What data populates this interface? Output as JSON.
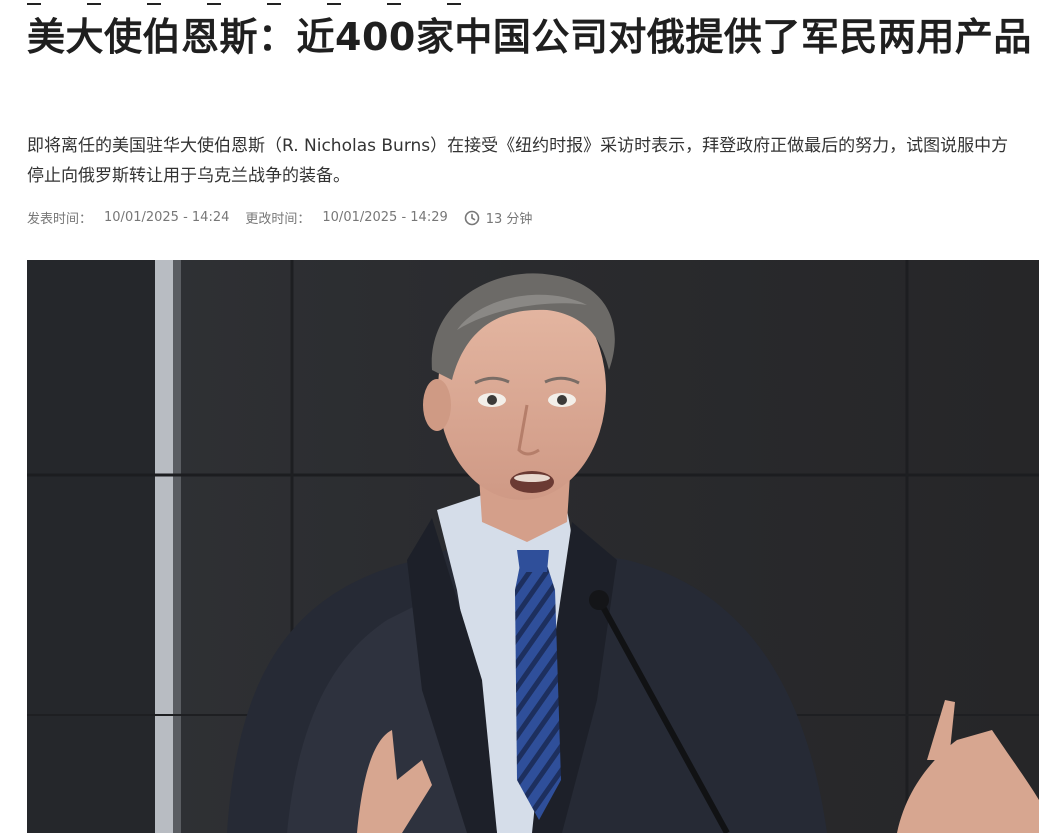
{
  "article": {
    "headline": "美大使伯恩斯：近400家中国公司对俄提供了军民两用产品",
    "lead": "即将离任的美国驻华大使伯恩斯（R. Nicholas Burns）在接受《纽约时报》采访时表示，拜登政府正做最后的努力，试图说服中方停止向俄罗斯转让用于乌克兰战争的装备。",
    "meta": {
      "published_label": "发表时间：",
      "published_value": "10/01/2025 - 14:24",
      "updated_label": "更改时间：",
      "updated_value": "10/01/2025 - 14:29",
      "read_time": "13 分钟"
    }
  },
  "icons": {
    "clock": "clock-icon"
  },
  "colors": {
    "headline": "#1f1f1f",
    "body_text": "#333333",
    "meta_text": "#777777",
    "photo_background": "#2a2a2c",
    "suit": "#262a35",
    "tie_blue": "#2f4f9a"
  }
}
